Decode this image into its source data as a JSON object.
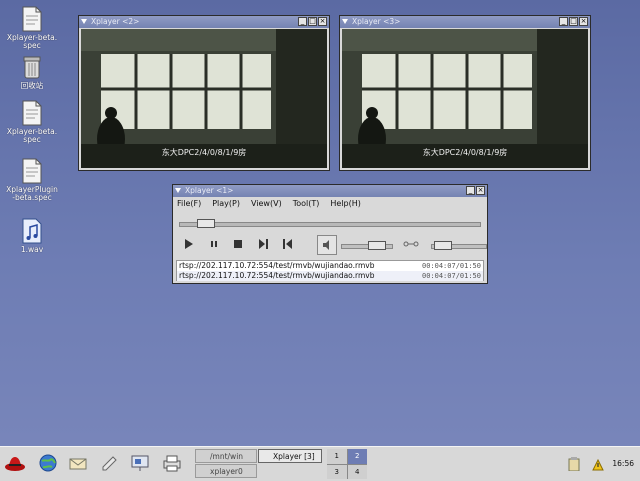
{
  "desktop": {
    "icons": [
      {
        "label": "Xplayer-beta.\nspec",
        "icon": "document-icon"
      },
      {
        "label": "回收站",
        "icon": "trash-icon"
      },
      {
        "label": "Xplayer-beta.\nspec",
        "icon": "document-icon"
      },
      {
        "label": "XplayerPlugin\n-beta.spec",
        "icon": "document-icon"
      },
      {
        "label": "1.wav",
        "icon": "audio-file-icon"
      }
    ]
  },
  "video_windows": [
    {
      "title": "Xplayer <2>",
      "caption": "东大DPC2/4/0/8/1/9房"
    },
    {
      "title": "Xplayer <3>",
      "caption": "东大DPC2/4/0/8/1/9房"
    }
  ],
  "player": {
    "title": "Xplayer <1>",
    "menu": [
      "File(F)",
      "Play(P)",
      "View(V)",
      "Tool(T)",
      "Help(H)"
    ],
    "seek_fraction": 0.06,
    "volume_fraction": 0.8,
    "playlist": [
      {
        "url": "rtsp://202.117.10.72:554/test/rmvb/wujiandao.rmvb",
        "time": "00:04:07/01:50"
      },
      {
        "url": "rtsp://202.117.10.72:554/test/rmvb/wujiandao.rmvb",
        "time": "00:04:07/01:50"
      }
    ]
  },
  "taskbar": {
    "tasks": [
      {
        "label": "/mnt/win"
      },
      {
        "label": "xplayer0"
      },
      {
        "label": "Xplayer [3]"
      }
    ],
    "pager": [
      "1",
      "2",
      "3",
      "4"
    ],
    "clock": "16:56"
  }
}
